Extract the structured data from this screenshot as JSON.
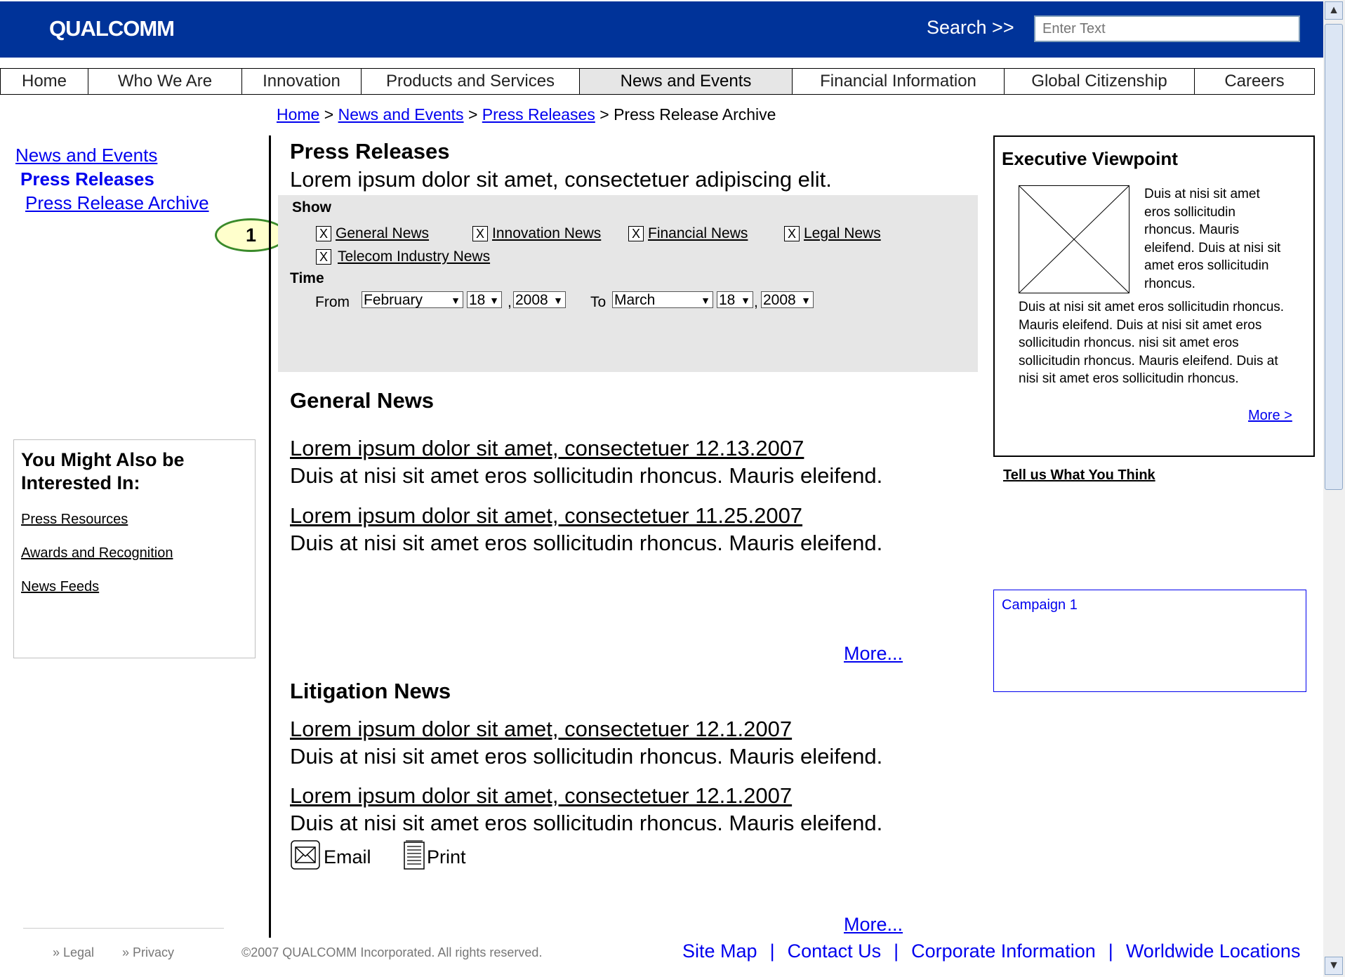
{
  "header": {
    "logo": "QUALCOMM",
    "search_label": "Search  >>",
    "search_placeholder": "Enter Text"
  },
  "nav": [
    {
      "label": "Home",
      "active": false
    },
    {
      "label": "Who We Are",
      "active": false
    },
    {
      "label": "Innovation",
      "active": false
    },
    {
      "label": "Products and Services",
      "active": false
    },
    {
      "label": "News and Events",
      "active": true
    },
    {
      "label": "Financial Information",
      "active": false
    },
    {
      "label": "Global Citizenship",
      "active": false
    },
    {
      "label": "Careers",
      "active": false
    }
  ],
  "breadcrumb": {
    "home": "Home",
    "news": "News and Events",
    "press": "Press Releases",
    "current": "Press Release Archive",
    "sep": " > "
  },
  "left_nav": {
    "item1": "News and Events",
    "item2": "Press Releases",
    "item3": "Press Release Archive"
  },
  "annotation": "1",
  "related": {
    "title": "You Might Also be Interested In:",
    "links": [
      "Press Resources",
      "Awards and Recognition",
      "News Feeds"
    ]
  },
  "main": {
    "title": "Press Releases",
    "subtitle": "Lorem ipsum dolor sit amet, consectetuer adipiscing elit.",
    "filter": {
      "show_label": "Show",
      "check_mark": "X",
      "categories": [
        "General News",
        "Innovation News",
        "Financial News",
        "Legal News",
        "Telecom Industry News"
      ],
      "time_label": "Time",
      "from_label": "From",
      "to_label": "To",
      "from_month": "February",
      "from_day": "18",
      "from_year": "2008",
      "to_month": "March",
      "to_day": "18",
      "to_year": "2008",
      "comma": ","
    },
    "general": {
      "title": "General News",
      "items": [
        {
          "title": "Lorem ipsum dolor sit amet, consectetuer 12.13.2007",
          "desc": "Duis at nisi sit amet eros sollicitudin rhoncus. Mauris eleifend."
        },
        {
          "title": "Lorem ipsum dolor sit amet, consectetuer 11.25.2007",
          "desc": "Duis at nisi sit amet eros sollicitudin rhoncus. Mauris eleifend."
        }
      ],
      "more": "More..."
    },
    "litigation": {
      "title": "Litigation News",
      "items": [
        {
          "title": "Lorem ipsum dolor sit amet, consectetuer 12.1.2007",
          "desc": "Duis at nisi sit amet eros sollicitudin rhoncus. Mauris eleifend."
        },
        {
          "title": "Lorem ipsum dolor sit amet, consectetuer 12.1.2007",
          "desc": "Duis at nisi sit amet eros sollicitudin rhoncus. Mauris eleifend."
        }
      ],
      "more": "More..."
    },
    "email_label": "Email",
    "print_label": "Print"
  },
  "right": {
    "exec_title": "Executive Viewpoint",
    "exec_text1": "Duis at nisi sit amet eros sollicitudin rhoncus. Mauris eleifend. Duis at nisi sit amet eros sollicitudin rhoncus.",
    "exec_text2": "Duis at nisi sit amet eros sollicitudin rhoncus. Mauris eleifend. Duis at nisi sit amet eros sollicitudin rhoncus. nisi sit amet eros sollicitudin rhoncus. Mauris eleifend. Duis at nisi sit amet eros sollicitudin rhoncus.",
    "exec_more": "More >",
    "feedback": "Tell us What You Think",
    "campaign": "Campaign 1"
  },
  "footer": {
    "legal": "» Legal",
    "privacy": "» Privacy",
    "copyright": "©2007 QUALCOMM Incorporated. All rights reserved.",
    "links": [
      "Site Map",
      "Contact Us",
      "Corporate Information",
      "Worldwide Locations"
    ],
    "sep": "|"
  },
  "colors": {
    "header_bg": "#003399",
    "link": "#0000ee",
    "filter_bg": "#e6e6e6",
    "annotation_border": "#3a8a2a",
    "annotation_fill": "#ffffcc"
  }
}
